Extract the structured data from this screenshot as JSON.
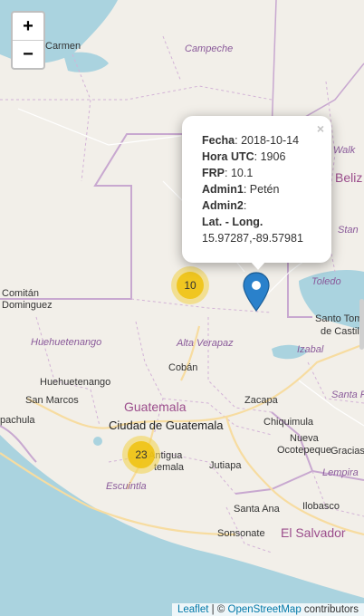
{
  "map": {
    "colors": {
      "land": "#f2efe9",
      "water": "#aad3df",
      "border": "#c8a8d0",
      "forest": "#e0e8d6"
    },
    "labels": {
      "ciudad": "ciudad",
      "carmen": "Carmen",
      "campeche": "Campeche",
      "walk": "Walk",
      "beliz": "Beliz",
      "stan": "Stan",
      "toledo": "Toledo",
      "santo_tomas": "Santo Tom",
      "de_castilla": "de Castil",
      "comitan": "Comitán",
      "dominguez": "Dominguez",
      "huehuetenango_dept": "Huehuetenango",
      "alta_verapaz": "Alta Verapaz",
      "izabal": "Izabal",
      "coban": "Cobán",
      "huehuetenango_city": "Huehuetenango",
      "san_marcos": "San Marcos",
      "guatemala_country": "Guatemala",
      "zacapa": "Zacapa",
      "santa_r": "Santa R",
      "pachula": "pachula",
      "ciudad_de_guatemala": "Ciudad de Guatemala",
      "chiquimula": "Chiquimula",
      "antigua": "Antigua",
      "guatemala_partial": "temala",
      "nueva": "Nueva",
      "ocotepeque": "Ocotepeque",
      "gracias": "Gracias",
      "jutiapa": "Jutiapa",
      "escuintla": "Escuintla",
      "lempira": "Lempira",
      "santa_ana": "Santa Ana",
      "ilobasco": "Ilobasco",
      "sonsonate": "Sonsonate",
      "el_salvador": "El Salvador"
    }
  },
  "zoom": {
    "in": "+",
    "out": "−"
  },
  "clusters": [
    {
      "count": "10"
    },
    {
      "count": "23"
    }
  ],
  "popup": {
    "close": "×",
    "fecha_label": "Fecha",
    "fecha": "2018-10-14",
    "hora_label": "Hora UTC",
    "hora": "1906",
    "frp_label": "FRP",
    "frp": "10.1",
    "admin1_label": "Admin1",
    "admin1": "Petén",
    "admin2_label": "Admin2",
    "admin2": "",
    "latlong_label": "Lat. - Long.",
    "latlong": "15.97287,-89.57981"
  },
  "attribution": {
    "leaflet": "Leaflet",
    "sep": " | © ",
    "osm": "OpenStreetMap",
    "contrib": " contributors"
  }
}
